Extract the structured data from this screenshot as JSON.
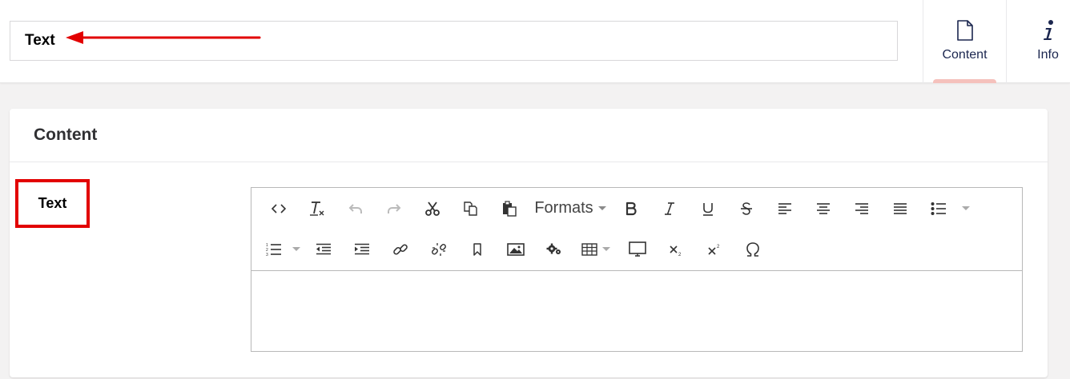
{
  "header": {
    "name_value": "Text"
  },
  "apps": [
    {
      "label": "Content",
      "icon": "document-icon",
      "active": true
    },
    {
      "label": "Info",
      "icon": "info-icon",
      "active": false
    }
  ],
  "group": {
    "title": "Content"
  },
  "property": {
    "label": "Text"
  },
  "toolbar": {
    "formats_label": "Formats"
  },
  "annotation": {
    "color": "#e20000"
  }
}
